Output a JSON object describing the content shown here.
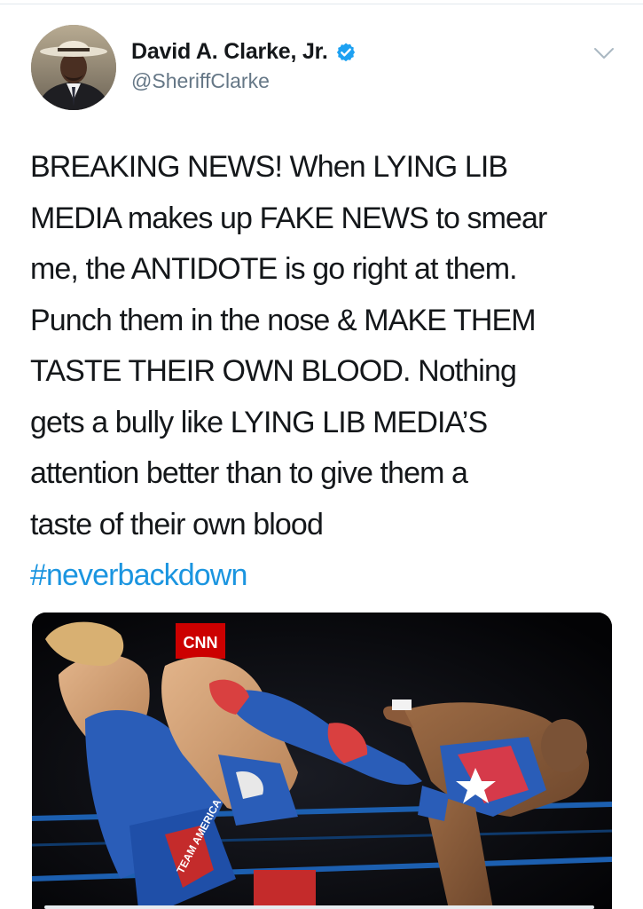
{
  "author": {
    "display_name": "David A. Clarke, Jr.",
    "handle": "@SheriffClarke",
    "verified": true
  },
  "tweet": {
    "lines": [
      "BREAKING NEWS! When LYING LIB",
      "MEDIA makes up FAKE NEWS to smear",
      "me, the ANTIDOTE is go right at them.",
      "Punch them in the nose & MAKE THEM",
      "TASTE THEIR OWN BLOOD. Nothing",
      "gets a bully like LYING LIB MEDIA’S",
      "attention better than to give them a",
      "taste of their own blood"
    ],
    "hashtag": "#neverbackdown"
  },
  "media": {
    "logo_text": "CNN",
    "tights_text": "TEAM AMERICA"
  },
  "icons": {
    "verified": "verified-badge-icon",
    "menu": "chevron-down-icon"
  },
  "colors": {
    "text": "#14171a",
    "secondary": "#657786",
    "link": "#1b95e0",
    "verified": "#1da1f2",
    "cnn_red": "#cc0000"
  }
}
